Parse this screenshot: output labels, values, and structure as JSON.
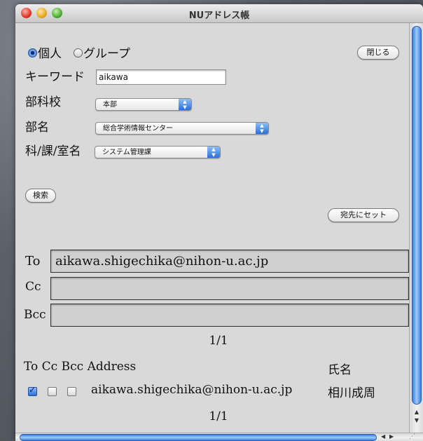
{
  "window": {
    "title": "NUアドレス帳"
  },
  "search_mode": {
    "individual_label": "個人",
    "group_label": "グループ",
    "selected": "individual"
  },
  "close_button": "閉じる",
  "keyword": {
    "label": "キーワード",
    "value": "aikawa"
  },
  "school": {
    "label": "部科校",
    "value": "本部"
  },
  "department": {
    "label": "部名",
    "value": "総合学術情報センター"
  },
  "section": {
    "label": "科/課/室名",
    "value": "システム管理課"
  },
  "search_button": "検索",
  "set_recipient_button": "宛先にセット",
  "recipients": {
    "to_label": "To",
    "to_value": "aikawa.shigechika@nihon-u.ac.jp",
    "cc_label": "Cc",
    "cc_value": "",
    "bcc_label": "Bcc",
    "bcc_value": ""
  },
  "page_indicator_top": "1/1",
  "results": {
    "headers": {
      "to": "To",
      "cc": "Cc",
      "bcc": "Bcc",
      "address": "Address",
      "name": "氏名"
    },
    "rows": [
      {
        "to": true,
        "cc": false,
        "bcc": false,
        "address": "aikawa.shigechika@nihon-u.ac.jp",
        "name": "相川成周"
      }
    ]
  },
  "page_indicator_bottom": "1/1",
  "colors": {
    "accent": "#2a6fd8",
    "window_bg": "#d9d9d9"
  }
}
